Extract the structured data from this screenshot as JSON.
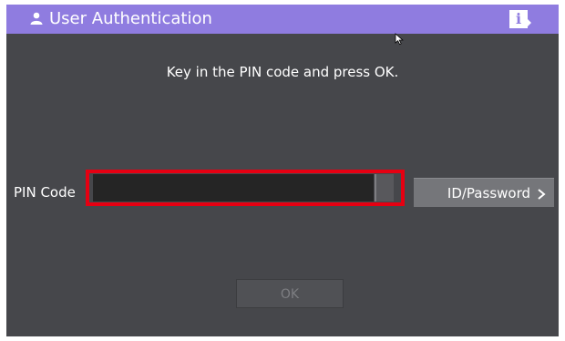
{
  "window": {
    "title": "User Authentication",
    "info_icon_glyph": "i"
  },
  "instruction": "Key in the PIN code and press OK.",
  "pin": {
    "label": "PIN Code",
    "value": ""
  },
  "id_password_button": {
    "label": "ID/Password"
  },
  "ok_button": {
    "label": "OK",
    "enabled": false
  },
  "colors": {
    "titlebar": "#8f7ce0",
    "panel_background": "#46474b",
    "field_background": "#252525",
    "highlight": "#e60012",
    "button": "#75767a",
    "ok_disabled_text": "#7d7e82"
  },
  "icons": {
    "title": "user-icon",
    "info": "info-icon",
    "cursor": "mouse-pointer-icon",
    "id_password_arrow": "chevron-right-icon"
  }
}
